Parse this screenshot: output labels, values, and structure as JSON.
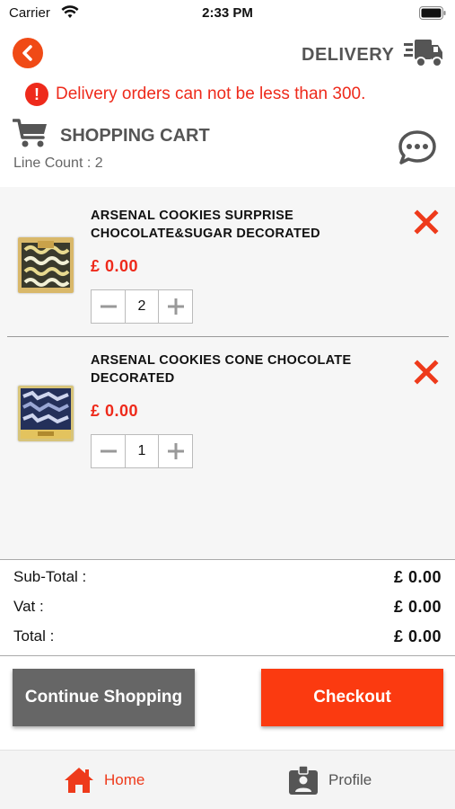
{
  "status_bar": {
    "carrier": "Carrier",
    "time": "2:33 PM"
  },
  "header": {
    "delivery_label": "DELIVERY",
    "alert_text": "Delivery orders can not be less than 300.",
    "alert_icon": "!",
    "cart_title": "SHOPPING CART",
    "line_count": "Line Count : 2"
  },
  "cart": {
    "items": [
      {
        "name": "ARSENAL COOKIES SURPRISE CHOCOLATE&SUGAR DECORATED",
        "price": "£ 0.00",
        "quantity": "2"
      },
      {
        "name": "ARSENAL COOKIES CONE CHOCOLATE DECORATED",
        "price": "£ 0.00",
        "quantity": "1"
      }
    ]
  },
  "totals": {
    "subtotal_label": "Sub-Total :",
    "subtotal_value": "£  0.00",
    "vat_label": "Vat :",
    "vat_value": "£  0.00",
    "total_label": "Total :",
    "total_value": "£  0.00"
  },
  "actions": {
    "continue_label": "Continue Shopping",
    "checkout_label": "Checkout"
  },
  "tabs": [
    {
      "label": "Home",
      "icon": "home-icon",
      "active": true
    },
    {
      "label": "Profile",
      "icon": "profile-badge-icon",
      "active": false
    }
  ],
  "colors": {
    "accent": "#f04a16",
    "alert": "#ee2a1b",
    "checkout": "#fb3a10",
    "continue": "#666666"
  }
}
